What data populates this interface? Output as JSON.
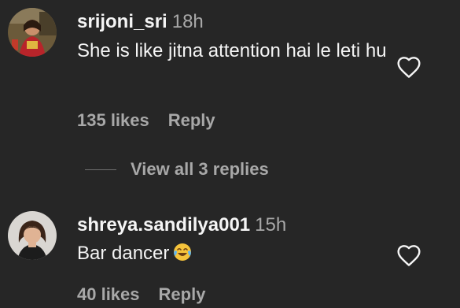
{
  "comments": [
    {
      "username": "srijoni_sri",
      "time": "18h",
      "text": "She is like jitna attention hai le leti hu",
      "likes": "135 likes",
      "reply": "Reply",
      "view_replies": "View all 3 replies"
    },
    {
      "username": "shreya.sandilya001",
      "time": "15h",
      "text": "Bar dancer",
      "emoji": "face-with-tears-of-joy",
      "likes": "40 likes",
      "reply": "Reply"
    }
  ],
  "colors": {
    "background": "#262626",
    "primary_text": "#f5f5f5",
    "secondary_text": "#a8a8a8"
  }
}
